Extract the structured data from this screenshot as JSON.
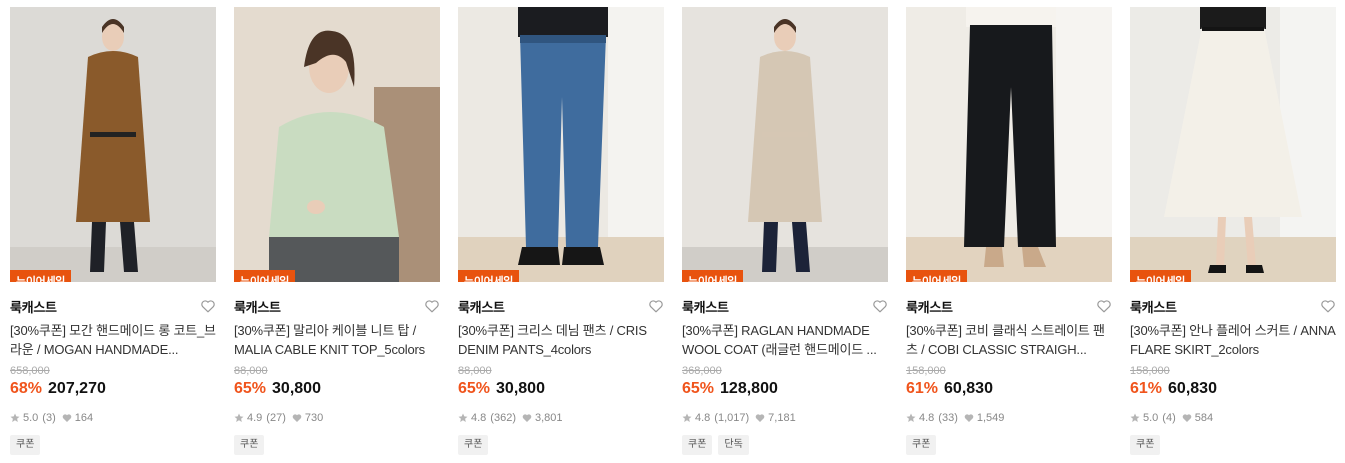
{
  "products": [
    {
      "badge": "뉴이어세일",
      "brand": "룩캐스트",
      "title": "[30%쿠폰] 모간 핸드메이드 롱 코트_브라운 / MOGAN HANDMADE...",
      "original_price": "658,000",
      "discount": "68%",
      "price": "207,270",
      "rating": "5.0",
      "reviews": "(3)",
      "likes": "164",
      "tags": [
        "쿠폰"
      ],
      "colors": {
        "bg": "#dcdad6",
        "garment": "#8a5a2b",
        "accent": "#1f2127"
      }
    },
    {
      "badge": "뉴이어세일",
      "brand": "룩캐스트",
      "title": "[30%쿠폰] 말리아 케이블 니트 탑 / MALIA CABLE KNIT TOP_5colors",
      "original_price": "88,000",
      "discount": "65%",
      "price": "30,800",
      "rating": "4.9",
      "reviews": "(27)",
      "likes": "730",
      "tags": [
        "쿠폰"
      ],
      "colors": {
        "bg": "#e4dbcf",
        "garment": "#c9dcc1",
        "accent": "#7a5232"
      }
    },
    {
      "badge": "뉴이어세일",
      "brand": "룩캐스트",
      "title": "[30%쿠폰] 크리스 데님 팬츠 / CRIS DENIM PANTS_4colors",
      "original_price": "88,000",
      "discount": "65%",
      "price": "30,800",
      "rating": "4.8",
      "reviews": "(362)",
      "likes": "3,801",
      "tags": [
        "쿠폰"
      ],
      "colors": {
        "bg": "#ece9e3",
        "garment": "#3f6c9e",
        "accent": "#c98f59"
      }
    },
    {
      "badge": "뉴이어세일",
      "brand": "룩캐스트",
      "title": "[30%쿠폰] RAGLAN HANDMADE WOOL COAT (래글런 핸드메이드 ...",
      "original_price": "368,000",
      "discount": "65%",
      "price": "128,800",
      "rating": "4.8",
      "reviews": "(1,017)",
      "likes": "7,181",
      "tags": [
        "쿠폰",
        "단독"
      ],
      "colors": {
        "bg": "#e6e3de",
        "garment": "#d5c7b4",
        "accent": "#1c2338"
      }
    },
    {
      "badge": "뉴이어세일",
      "brand": "룩캐스트",
      "title": "[30%쿠폰] 코비 클래식 스트레이트 팬츠 / COBI CLASSIC STRAIGH...",
      "original_price": "158,000",
      "discount": "61%",
      "price": "60,830",
      "rating": "4.8",
      "reviews": "(33)",
      "likes": "1,549",
      "tags": [
        "쿠폰"
      ],
      "colors": {
        "bg": "#efece6",
        "garment": "#17191c",
        "accent": "#c9a98a"
      }
    },
    {
      "badge": "뉴이어세일",
      "brand": "룩캐스트",
      "title": "[30%쿠폰] 안나 플레어 스커트 / ANNA FLARE SKIRT_2colors",
      "original_price": "158,000",
      "discount": "61%",
      "price": "60,830",
      "rating": "5.0",
      "reviews": "(4)",
      "likes": "584",
      "tags": [
        "쿠폰"
      ],
      "colors": {
        "bg": "#ecebe7",
        "garment": "#f3f0e8",
        "accent": "#141414"
      }
    }
  ]
}
